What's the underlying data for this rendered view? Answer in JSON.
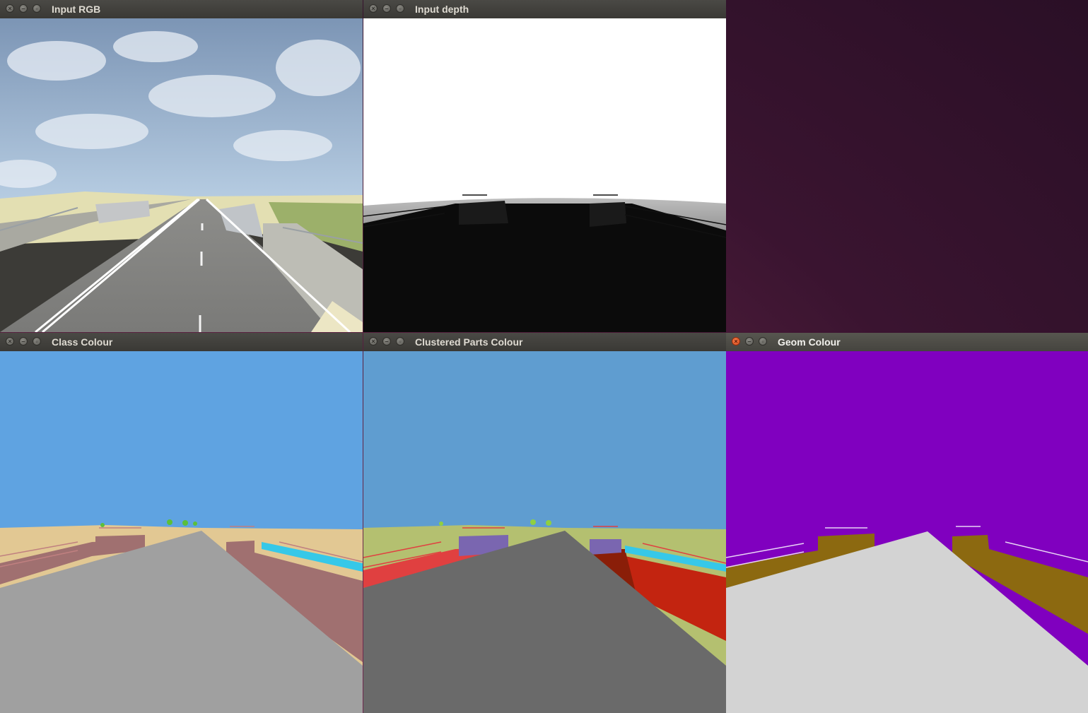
{
  "windows": {
    "input_rgb": {
      "title": "Input RGB"
    },
    "input_depth": {
      "title": "Input depth"
    },
    "class_colour": {
      "title": "Class Colour"
    },
    "clustered_parts_colour": {
      "title": "Clustered Parts Colour"
    },
    "geom_colour": {
      "title": "Geom Colour"
    }
  },
  "colors": {
    "desktop": "#3a1430",
    "titlebar": "#3c3b37",
    "close_button_active": "#e5572a",
    "class_sky": "#5fa3e1",
    "class_ground": "#e2c893",
    "class_road": "#a0a0a0",
    "class_wall": "#a07070",
    "parts_sky": "#5f9dd0",
    "parts_ground": "#b4c070",
    "parts_road": "#6a6a6a",
    "parts_red": "#c32410",
    "parts_purple": "#7a66b0",
    "geom_sky": "#8000bf",
    "geom_ground": "#d3d3d3",
    "geom_structure": "#8c6910"
  },
  "icons": [
    "close-icon",
    "minimize-icon",
    "maximize-icon"
  ]
}
